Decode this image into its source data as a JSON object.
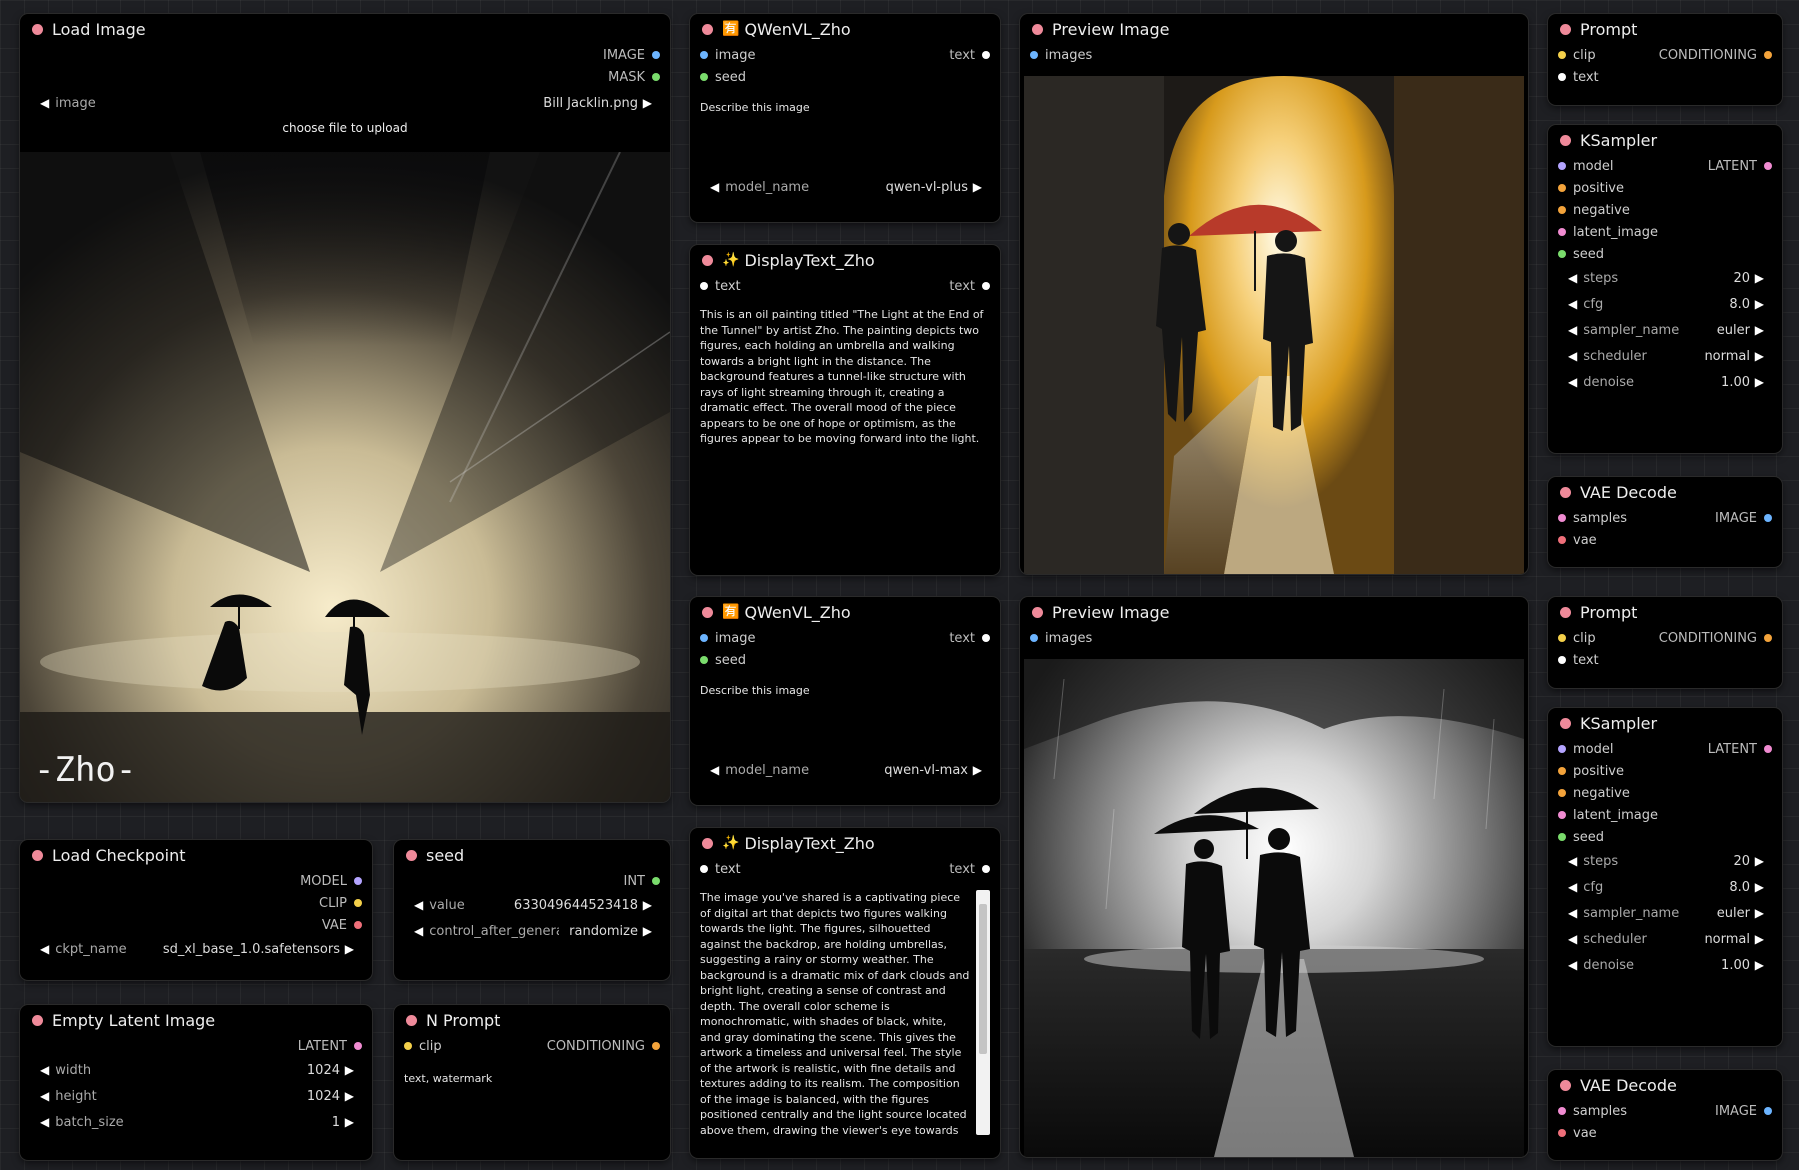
{
  "load_image": {
    "title": "Load Image",
    "outputs": [
      "IMAGE",
      "MASK"
    ],
    "image_label": "image",
    "image_value": "Bill Jacklin.png",
    "upload_label": "choose file to upload",
    "watermark": "-Zho-"
  },
  "qwen1": {
    "emoji": "🈶",
    "title": "QWenVL_Zho",
    "in": [
      "image",
      "seed"
    ],
    "out": "text",
    "prompt": "Describe this image",
    "model_label": "model_name",
    "model_value": "qwen-vl-plus"
  },
  "display1": {
    "emoji": "✨",
    "title": "DisplayText_Zho",
    "in": "text",
    "out": "text",
    "content": "This is an oil painting titled \"The Light at the End of the Tunnel\" by artist Zho. The painting depicts two figures, each holding an umbrella and walking towards a bright light in the distance. The background features a tunnel-like structure with rays of light streaming through it, creating a dramatic effect. The overall mood of the piece appears to be one of hope or optimism, as the figures appear to be moving forward into the light."
  },
  "qwen2": {
    "emoji": "🈶",
    "title": "QWenVL_Zho",
    "in": [
      "image",
      "seed"
    ],
    "out": "text",
    "prompt": "Describe this image",
    "model_label": "model_name",
    "model_value": "qwen-vl-max"
  },
  "display2": {
    "emoji": "✨",
    "title": "DisplayText_Zho",
    "in": "text",
    "out": "text",
    "content": "The image you've shared is a captivating piece of digital art that depicts two figures walking towards the light. The figures, silhouetted against the backdrop, are holding umbrellas, suggesting a rainy or stormy weather. The background is a dramatic mix of dark clouds and bright light, creating a sense of contrast and depth. The overall color scheme is monochromatic, with shades of black, white, and gray dominating the scene. This gives the artwork a timeless and universal feel. The style of the artwork is realistic, with fine details and textures adding to its realism. The composition of the image is balanced, with the figures positioned centrally and the light source located above them, drawing the viewer's eye towards them. The artwork"
  },
  "preview1": {
    "title": "Preview Image",
    "in": "images"
  },
  "preview2": {
    "title": "Preview Image",
    "in": "images"
  },
  "prompt1": {
    "title": "Prompt",
    "in": [
      "clip",
      "text"
    ],
    "out": "CONDITIONING"
  },
  "prompt2": {
    "title": "Prompt",
    "in": [
      "clip",
      "text"
    ],
    "out": "CONDITIONING"
  },
  "ksampler": {
    "title": "KSampler",
    "in": [
      "model",
      "positive",
      "negative",
      "latent_image",
      "seed"
    ],
    "out": "LATENT",
    "widgets": [
      {
        "label": "steps",
        "value": "20"
      },
      {
        "label": "cfg",
        "value": "8.0"
      },
      {
        "label": "sampler_name",
        "value": "euler"
      },
      {
        "label": "scheduler",
        "value": "normal"
      },
      {
        "label": "denoise",
        "value": "1.00"
      }
    ]
  },
  "vae": {
    "title": "VAE Decode",
    "in": [
      "samples",
      "vae"
    ],
    "out": "IMAGE"
  },
  "checkpoint": {
    "title": "Load Checkpoint",
    "outputs": [
      "MODEL",
      "CLIP",
      "VAE"
    ],
    "ckpt_label": "ckpt_name",
    "ckpt_value": "sd_xl_base_1.0.safetensors"
  },
  "seed": {
    "title": "seed",
    "out": "INT",
    "value_label": "value",
    "value": "633049644523418",
    "control_label": "control_after_generate",
    "control_value": "randomize"
  },
  "latent": {
    "title": "Empty Latent Image",
    "out": "LATENT",
    "widgets": [
      {
        "label": "width",
        "value": "1024"
      },
      {
        "label": "height",
        "value": "1024"
      },
      {
        "label": "batch_size",
        "value": "1"
      }
    ]
  },
  "nprompt": {
    "title": "N Prompt",
    "in": "clip",
    "out": "CONDITIONING",
    "text": "text, watermark"
  },
  "colors": {
    "title_dot": "#ef8a9a",
    "canvas": "#1e1f23",
    "node": "#000000"
  }
}
